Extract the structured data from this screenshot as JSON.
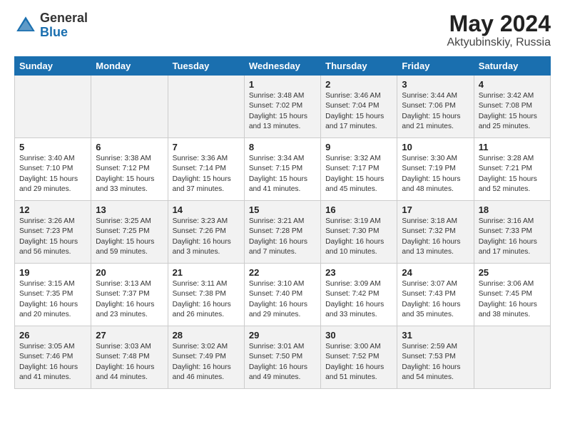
{
  "logo": {
    "general": "General",
    "blue": "Blue"
  },
  "title": {
    "month_year": "May 2024",
    "location": "Aktyubinskiy, Russia"
  },
  "days_of_week": [
    "Sunday",
    "Monday",
    "Tuesday",
    "Wednesday",
    "Thursday",
    "Friday",
    "Saturday"
  ],
  "weeks": [
    [
      {
        "day": null,
        "sunrise": null,
        "sunset": null,
        "daylight": null
      },
      {
        "day": null,
        "sunrise": null,
        "sunset": null,
        "daylight": null
      },
      {
        "day": null,
        "sunrise": null,
        "sunset": null,
        "daylight": null
      },
      {
        "day": "1",
        "sunrise": "Sunrise: 3:48 AM",
        "sunset": "Sunset: 7:02 PM",
        "daylight": "Daylight: 15 hours and 13 minutes."
      },
      {
        "day": "2",
        "sunrise": "Sunrise: 3:46 AM",
        "sunset": "Sunset: 7:04 PM",
        "daylight": "Daylight: 15 hours and 17 minutes."
      },
      {
        "day": "3",
        "sunrise": "Sunrise: 3:44 AM",
        "sunset": "Sunset: 7:06 PM",
        "daylight": "Daylight: 15 hours and 21 minutes."
      },
      {
        "day": "4",
        "sunrise": "Sunrise: 3:42 AM",
        "sunset": "Sunset: 7:08 PM",
        "daylight": "Daylight: 15 hours and 25 minutes."
      }
    ],
    [
      {
        "day": "5",
        "sunrise": "Sunrise: 3:40 AM",
        "sunset": "Sunset: 7:10 PM",
        "daylight": "Daylight: 15 hours and 29 minutes."
      },
      {
        "day": "6",
        "sunrise": "Sunrise: 3:38 AM",
        "sunset": "Sunset: 7:12 PM",
        "daylight": "Daylight: 15 hours and 33 minutes."
      },
      {
        "day": "7",
        "sunrise": "Sunrise: 3:36 AM",
        "sunset": "Sunset: 7:14 PM",
        "daylight": "Daylight: 15 hours and 37 minutes."
      },
      {
        "day": "8",
        "sunrise": "Sunrise: 3:34 AM",
        "sunset": "Sunset: 7:15 PM",
        "daylight": "Daylight: 15 hours and 41 minutes."
      },
      {
        "day": "9",
        "sunrise": "Sunrise: 3:32 AM",
        "sunset": "Sunset: 7:17 PM",
        "daylight": "Daylight: 15 hours and 45 minutes."
      },
      {
        "day": "10",
        "sunrise": "Sunrise: 3:30 AM",
        "sunset": "Sunset: 7:19 PM",
        "daylight": "Daylight: 15 hours and 48 minutes."
      },
      {
        "day": "11",
        "sunrise": "Sunrise: 3:28 AM",
        "sunset": "Sunset: 7:21 PM",
        "daylight": "Daylight: 15 hours and 52 minutes."
      }
    ],
    [
      {
        "day": "12",
        "sunrise": "Sunrise: 3:26 AM",
        "sunset": "Sunset: 7:23 PM",
        "daylight": "Daylight: 15 hours and 56 minutes."
      },
      {
        "day": "13",
        "sunrise": "Sunrise: 3:25 AM",
        "sunset": "Sunset: 7:25 PM",
        "daylight": "Daylight: 15 hours and 59 minutes."
      },
      {
        "day": "14",
        "sunrise": "Sunrise: 3:23 AM",
        "sunset": "Sunset: 7:26 PM",
        "daylight": "Daylight: 16 hours and 3 minutes."
      },
      {
        "day": "15",
        "sunrise": "Sunrise: 3:21 AM",
        "sunset": "Sunset: 7:28 PM",
        "daylight": "Daylight: 16 hours and 7 minutes."
      },
      {
        "day": "16",
        "sunrise": "Sunrise: 3:19 AM",
        "sunset": "Sunset: 7:30 PM",
        "daylight": "Daylight: 16 hours and 10 minutes."
      },
      {
        "day": "17",
        "sunrise": "Sunrise: 3:18 AM",
        "sunset": "Sunset: 7:32 PM",
        "daylight": "Daylight: 16 hours and 13 minutes."
      },
      {
        "day": "18",
        "sunrise": "Sunrise: 3:16 AM",
        "sunset": "Sunset: 7:33 PM",
        "daylight": "Daylight: 16 hours and 17 minutes."
      }
    ],
    [
      {
        "day": "19",
        "sunrise": "Sunrise: 3:15 AM",
        "sunset": "Sunset: 7:35 PM",
        "daylight": "Daylight: 16 hours and 20 minutes."
      },
      {
        "day": "20",
        "sunrise": "Sunrise: 3:13 AM",
        "sunset": "Sunset: 7:37 PM",
        "daylight": "Daylight: 16 hours and 23 minutes."
      },
      {
        "day": "21",
        "sunrise": "Sunrise: 3:11 AM",
        "sunset": "Sunset: 7:38 PM",
        "daylight": "Daylight: 16 hours and 26 minutes."
      },
      {
        "day": "22",
        "sunrise": "Sunrise: 3:10 AM",
        "sunset": "Sunset: 7:40 PM",
        "daylight": "Daylight: 16 hours and 29 minutes."
      },
      {
        "day": "23",
        "sunrise": "Sunrise: 3:09 AM",
        "sunset": "Sunset: 7:42 PM",
        "daylight": "Daylight: 16 hours and 33 minutes."
      },
      {
        "day": "24",
        "sunrise": "Sunrise: 3:07 AM",
        "sunset": "Sunset: 7:43 PM",
        "daylight": "Daylight: 16 hours and 35 minutes."
      },
      {
        "day": "25",
        "sunrise": "Sunrise: 3:06 AM",
        "sunset": "Sunset: 7:45 PM",
        "daylight": "Daylight: 16 hours and 38 minutes."
      }
    ],
    [
      {
        "day": "26",
        "sunrise": "Sunrise: 3:05 AM",
        "sunset": "Sunset: 7:46 PM",
        "daylight": "Daylight: 16 hours and 41 minutes."
      },
      {
        "day": "27",
        "sunrise": "Sunrise: 3:03 AM",
        "sunset": "Sunset: 7:48 PM",
        "daylight": "Daylight: 16 hours and 44 minutes."
      },
      {
        "day": "28",
        "sunrise": "Sunrise: 3:02 AM",
        "sunset": "Sunset: 7:49 PM",
        "daylight": "Daylight: 16 hours and 46 minutes."
      },
      {
        "day": "29",
        "sunrise": "Sunrise: 3:01 AM",
        "sunset": "Sunset: 7:50 PM",
        "daylight": "Daylight: 16 hours and 49 minutes."
      },
      {
        "day": "30",
        "sunrise": "Sunrise: 3:00 AM",
        "sunset": "Sunset: 7:52 PM",
        "daylight": "Daylight: 16 hours and 51 minutes."
      },
      {
        "day": "31",
        "sunrise": "Sunrise: 2:59 AM",
        "sunset": "Sunset: 7:53 PM",
        "daylight": "Daylight: 16 hours and 54 minutes."
      },
      {
        "day": null,
        "sunrise": null,
        "sunset": null,
        "daylight": null
      }
    ]
  ]
}
